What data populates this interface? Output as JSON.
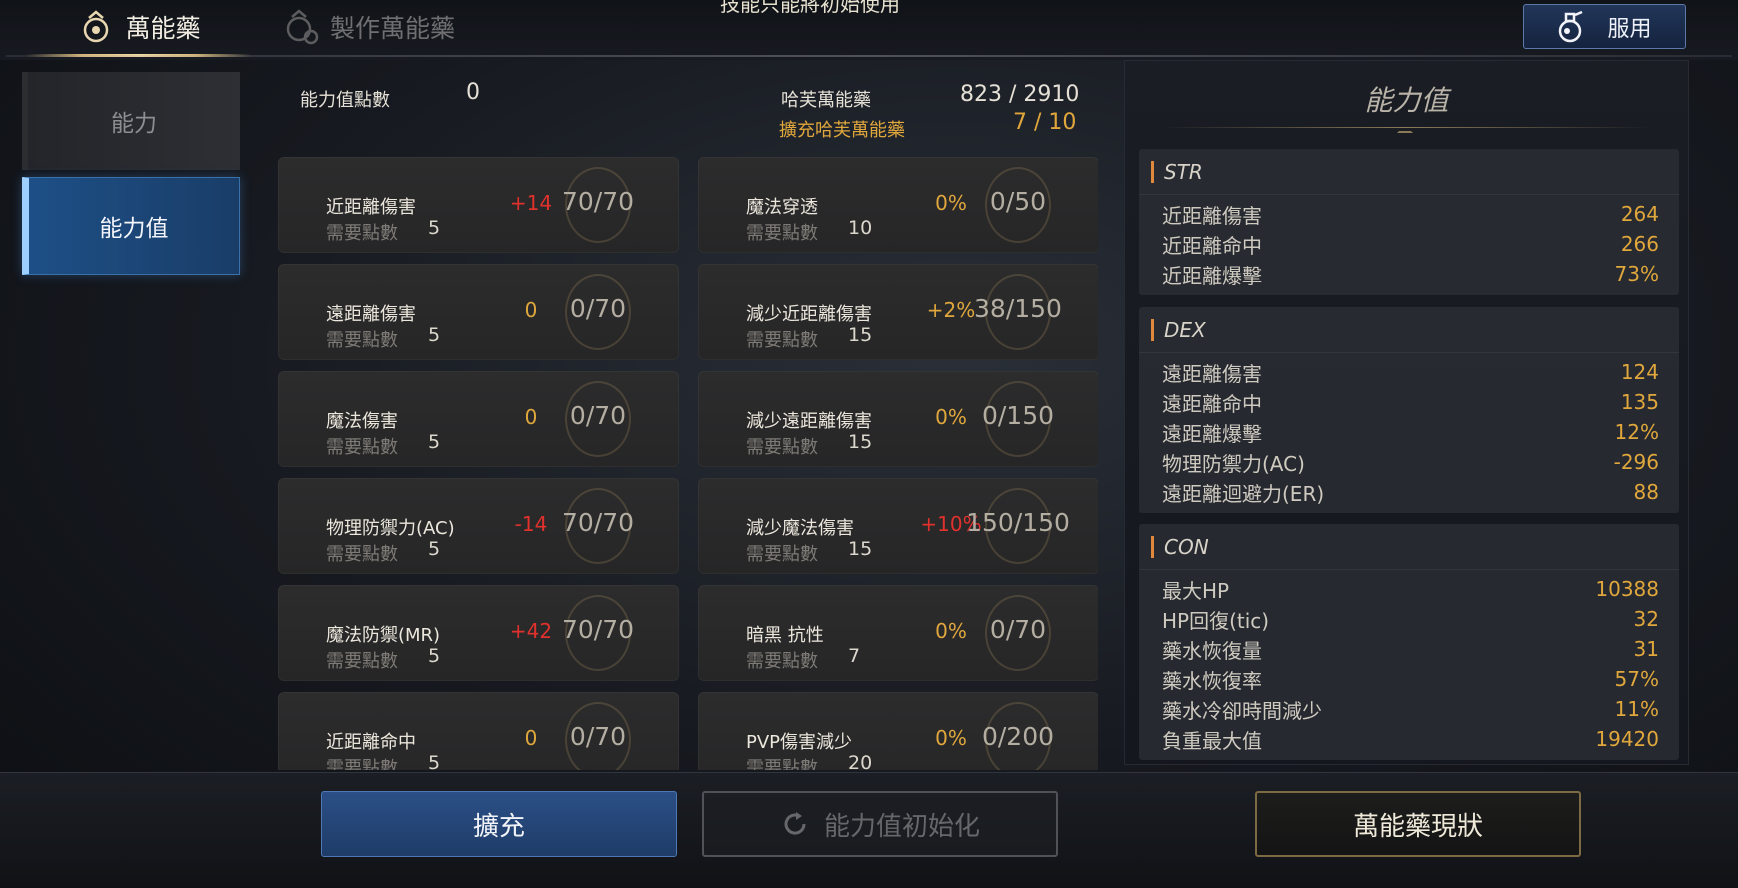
{
  "tabs": [
    {
      "label": "萬能藥",
      "icon": "elixir-icon",
      "active": true
    },
    {
      "label": "製作萬能藥",
      "icon": "craft-elixir-icon",
      "active": false
    }
  ],
  "notice": "技能只能將初始使用",
  "use_button": {
    "label": "服用",
    "icon": "potion-icon"
  },
  "sidebar": {
    "items": [
      {
        "label": "能力"
      },
      {
        "label": "能力值"
      }
    ]
  },
  "summary": {
    "points_label": "能力值點數",
    "points_value": "0",
    "elixir_label": "哈芙萬能藥",
    "elixir_value": "823 / 2910",
    "expand_label": "擴充哈芙萬能藥",
    "expand_value": "7 / 10"
  },
  "cards": [
    {
      "name": "近距離傷害",
      "req_label": "需要點數",
      "req": "5",
      "delta": "+14",
      "cap": "70/70",
      "delta_color": "red"
    },
    {
      "name": "魔法穿透",
      "req_label": "需要點數",
      "req": "10",
      "delta": "0%",
      "cap": "0/50",
      "delta_color": "gold"
    },
    {
      "name": "遠距離傷害",
      "req_label": "需要點數",
      "req": "5",
      "delta": "0",
      "cap": "0/70",
      "delta_color": "gold"
    },
    {
      "name": "減少近距離傷害",
      "req_label": "需要點數",
      "req": "15",
      "delta": "+2%",
      "cap": "38/150",
      "delta_color": "gold"
    },
    {
      "name": "魔法傷害",
      "req_label": "需要點數",
      "req": "5",
      "delta": "0",
      "cap": "0/70",
      "delta_color": "gold"
    },
    {
      "name": "減少遠距離傷害",
      "req_label": "需要點數",
      "req": "15",
      "delta": "0%",
      "cap": "0/150",
      "delta_color": "gold"
    },
    {
      "name": "物理防禦力(AC)",
      "req_label": "需要點數",
      "req": "5",
      "delta": "-14",
      "cap": "70/70",
      "delta_color": "red"
    },
    {
      "name": "減少魔法傷害",
      "req_label": "需要點數",
      "req": "15",
      "delta": "+10%",
      "cap": "150/150",
      "delta_color": "red"
    },
    {
      "name": "魔法防禦(MR)",
      "req_label": "需要點數",
      "req": "5",
      "delta": "+42",
      "cap": "70/70",
      "delta_color": "red"
    },
    {
      "name": "暗黑 抗性",
      "req_label": "需要點數",
      "req": "7",
      "delta": "0%",
      "cap": "0/70",
      "delta_color": "gold"
    },
    {
      "name": "近距離命中",
      "req_label": "需要點數",
      "req": "5",
      "delta": "0",
      "cap": "0/70",
      "delta_color": "gold"
    },
    {
      "name": "PVP傷害減少",
      "req_label": "需要點數",
      "req": "20",
      "delta": "0%",
      "cap": "0/200",
      "delta_color": "gold"
    }
  ],
  "stats": {
    "title": "能力值",
    "groups": [
      {
        "name": "STR",
        "rows": [
          {
            "k": "近距離傷害",
            "v": "264"
          },
          {
            "k": "近距離命中",
            "v": "266"
          },
          {
            "k": "近距離爆擊",
            "v": "73%"
          }
        ]
      },
      {
        "name": "DEX",
        "rows": [
          {
            "k": "遠距離傷害",
            "v": "124"
          },
          {
            "k": "遠距離命中",
            "v": "135"
          },
          {
            "k": "遠距離爆擊",
            "v": "12%"
          },
          {
            "k": "物理防禦力(AC)",
            "v": "-296"
          },
          {
            "k": "遠距離迴避力(ER)",
            "v": "88"
          }
        ]
      },
      {
        "name": "CON",
        "rows": [
          {
            "k": "最大HP",
            "v": "10388"
          },
          {
            "k": "HP回復(tic)",
            "v": "32"
          },
          {
            "k": "藥水恢復量",
            "v": "31"
          },
          {
            "k": "藥水恢復率",
            "v": "57%"
          },
          {
            "k": "藥水冷卻時間減少",
            "v": "11%"
          },
          {
            "k": "負重最大值",
            "v": "19420"
          }
        ]
      }
    ]
  },
  "buttons": {
    "expand": "擴充",
    "reset": "能力值初始化",
    "status": "萬能藥現狀"
  },
  "colors": {
    "accent_gold": "#e0a73c",
    "delta_red": "#e0312c",
    "active_blue": "#1d4f86"
  }
}
